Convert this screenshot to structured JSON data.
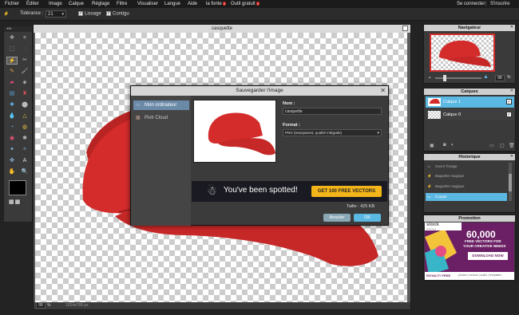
{
  "menubar": {
    "items": [
      "Fichier",
      "Éditer",
      "Image",
      "Calque",
      "Réglage",
      "Filtre",
      "Visualiser",
      "Langue",
      "Aide"
    ],
    "la_fonte": "la fonte",
    "outil_gratuit": "Outil gratuit",
    "badge": "4",
    "login": "Se connecter",
    "signup": "S'inscrire",
    "separator": "|"
  },
  "options": {
    "tolerance_label": "Tolérance :",
    "tolerance_value": "21",
    "smoothing_label": "Lissage",
    "contiguous_label": "Contigu"
  },
  "document": {
    "title": "casquette",
    "zoom": "88",
    "zoom_unit": "%",
    "size": "1024x768 px"
  },
  "dialog": {
    "title": "Sauvegarder l'image",
    "side": [
      "Mon ordinateur",
      "Pixlr Cloud"
    ],
    "name_label": "Nom :",
    "name_value": "casquette",
    "format_label": "Format :",
    "format_value": "PNG (transparent, qualité intégrale)",
    "ad_text": "You've been spotted!",
    "ad_button": "GET 100 FREE VECTORS",
    "size_label": "Taille : 425 KB",
    "cancel": "Annuler",
    "ok": "OK"
  },
  "navigator": {
    "title": "Navigateur",
    "zoom": "88",
    "unit": "%"
  },
  "layers": {
    "title": "Calques",
    "items": [
      "Calque 1",
      "Calque 0"
    ]
  },
  "history": {
    "title": "Historique",
    "items": [
      "Ouvrir l'image",
      "Baguette magique",
      "Baguette magique",
      "Couper"
    ]
  },
  "promo": {
    "title": "Promotion",
    "brand": "stock",
    "brand2": "unlimited",
    "headline": "60,000",
    "line1": "FREE VECTORS FOR",
    "line2": "YOUR CREATIVE NEEDS",
    "button": "DOWNLOAD NOW",
    "footer": "ROYALTY FREE",
    "footer2": "photos | vectors | audio | templates"
  },
  "colors": {
    "accent": "#5bb8e2",
    "cap": "#d42b2b",
    "ad_button": "#f4b51a"
  }
}
